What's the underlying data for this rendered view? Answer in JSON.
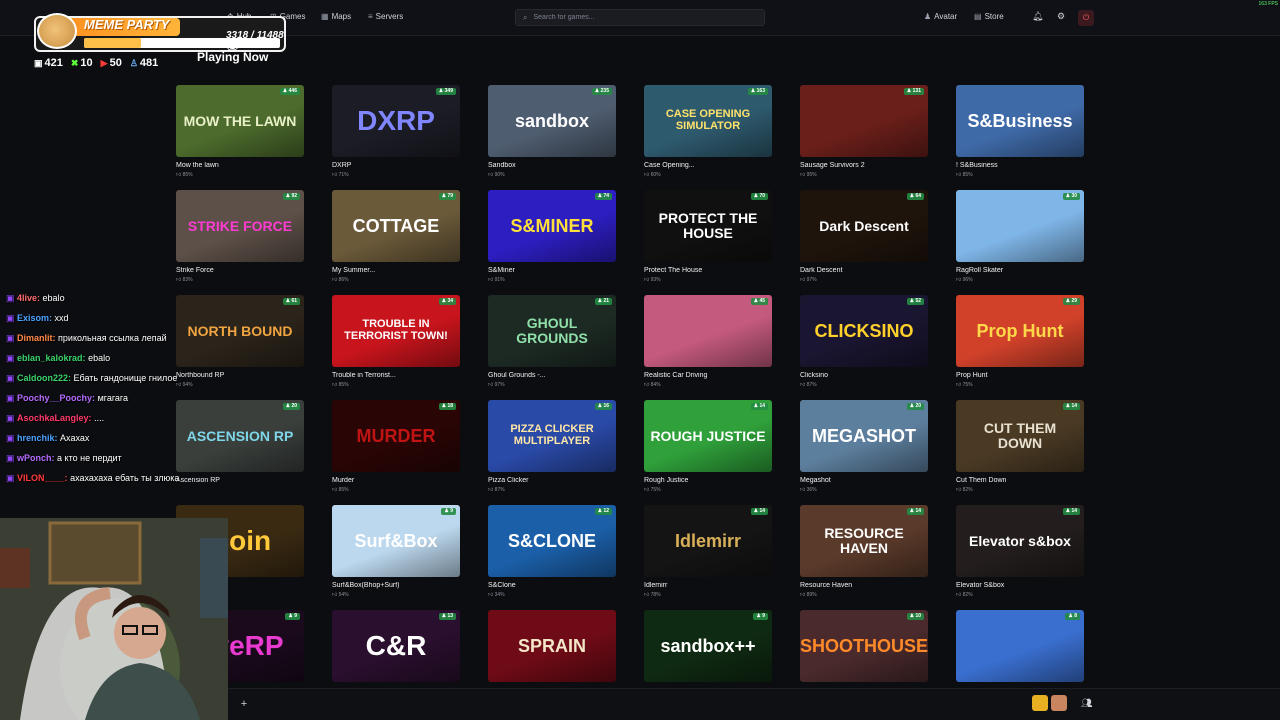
{
  "topbar": {
    "nav": [
      {
        "label": "Hub",
        "icon": "hub-icon"
      },
      {
        "label": "Games",
        "icon": "gamepad-icon"
      },
      {
        "label": "Maps",
        "icon": "map-icon"
      },
      {
        "label": "Servers",
        "icon": "list-icon"
      }
    ],
    "search_placeholder": "Search for games...",
    "avatar_label": "Avatar",
    "store_label": "Store",
    "fps": "163 FPS"
  },
  "section_title": "Playing Now",
  "games": [
    {
      "title": "Mow the lawn",
      "rating": "85%",
      "players": "446",
      "thumb_text": "MOW THE LAWN",
      "bg": "#4c6b2c",
      "fg": "#e8f0c8"
    },
    {
      "title": "DXRP",
      "rating": "71%",
      "players": "349",
      "thumb_text": "DXRP",
      "bg": "#1c1c26",
      "fg": "#7f86ff"
    },
    {
      "title": "Sandbox",
      "rating": "90%",
      "players": "235",
      "thumb_text": "sandbox",
      "bg": "#4f5d70",
      "fg": "#ffffff"
    },
    {
      "title": "Case Opening...",
      "rating": "60%",
      "players": "163",
      "thumb_text": "CASE OPENING SIMULATOR",
      "bg": "#2e5a6e",
      "fg": "#ffe26b"
    },
    {
      "title": "Sausage Survivors 2",
      "rating": "95%",
      "players": "131",
      "thumb_text": "",
      "bg": "#6b1f1a",
      "fg": "#ffffff"
    },
    {
      "title": "! S&Business",
      "rating": "85%",
      "players": "",
      "thumb_text": "S&Business",
      "bg": "#3f6aa8",
      "fg": "#ffffff"
    },
    {
      "title": "Strike Force",
      "rating": "83%",
      "players": "92",
      "thumb_text": "STRIKE FORCE",
      "bg": "#5d5048",
      "fg": "#ff3bd3"
    },
    {
      "title": "My Summer...",
      "rating": "86%",
      "players": "79",
      "thumb_text": "COTTAGE",
      "bg": "#6b5a3a",
      "fg": "#ffffff"
    },
    {
      "title": "S&Miner",
      "rating": "91%",
      "players": "74",
      "thumb_text": "S&MINER",
      "bg": "#2d1ec2",
      "fg": "#ffe03a"
    },
    {
      "title": "Protect The House",
      "rating": "93%",
      "players": "70",
      "thumb_text": "PROTECT THE HOUSE",
      "bg": "#101010",
      "fg": "#ffffff"
    },
    {
      "title": "Dark Descent",
      "rating": "97%",
      "players": "64",
      "thumb_text": "Dark Descent",
      "bg": "#1f140c",
      "fg": "#ffffff"
    },
    {
      "title": "RagRoll Skater",
      "rating": "96%",
      "players": "30",
      "thumb_text": "",
      "bg": "#7fb6e8",
      "fg": "#ffffff"
    },
    {
      "title": "Northbound RP",
      "rating": "94%",
      "players": "61",
      "thumb_text": "NORTH BOUND",
      "bg": "#2b241a",
      "fg": "#f0a441"
    },
    {
      "title": "Trouble in Terrorist...",
      "rating": "85%",
      "players": "34",
      "thumb_text": "TROUBLE IN TERRORIST TOWN!",
      "bg": "#c8141c",
      "fg": "#ffffff"
    },
    {
      "title": "Ghoul Grounds -...",
      "rating": "97%",
      "players": "21",
      "thumb_text": "GHOUL GROUNDS",
      "bg": "#1d2a24",
      "fg": "#8fe0a9"
    },
    {
      "title": "Realistic Car Driving",
      "rating": "84%",
      "players": "45",
      "thumb_text": "",
      "bg": "#c45a7d",
      "fg": "#ffffff"
    },
    {
      "title": "Clicksino",
      "rating": "87%",
      "players": "52",
      "thumb_text": "CLICKSINO",
      "bg": "#1a1530",
      "fg": "#ffd12a"
    },
    {
      "title": "Prop Hunt",
      "rating": "75%",
      "players": "29",
      "thumb_text": "Prop Hunt",
      "bg": "#d1412a",
      "fg": "#ffd84a"
    },
    {
      "title": "Ascension RP",
      "rating": "",
      "players": "20",
      "thumb_text": "ASCENSION RP",
      "bg": "#3a3f3c",
      "fg": "#7fd6e8"
    },
    {
      "title": "Murder",
      "rating": "85%",
      "players": "18",
      "thumb_text": "MURDER",
      "bg": "#2a0505",
      "fg": "#c01414"
    },
    {
      "title": "Pizza Clicker",
      "rating": "87%",
      "players": "16",
      "thumb_text": "PIZZA CLICKER MULTIPLAYER",
      "bg": "#2a4aa8",
      "fg": "#ffe7a6"
    },
    {
      "title": "Rough Justice",
      "rating": "75%",
      "players": "14",
      "thumb_text": "ROUGH JUSTICE",
      "bg": "#2fa03a",
      "fg": "#ffffff"
    },
    {
      "title": "Megashot",
      "rating": "36%",
      "players": "20",
      "thumb_text": "MEGASHOT",
      "bg": "#5d7f9e",
      "fg": "#ffffff"
    },
    {
      "title": "Cut Them Down",
      "rating": "82%",
      "players": "14",
      "thumb_text": "CUT THEM DOWN",
      "bg": "#4a3a24",
      "fg": "#e8e0d0"
    },
    {
      "title": "",
      "rating": "",
      "players": "",
      "thumb_text": "Coin",
      "bg": "#3a2a12",
      "fg": "#ffc93a"
    },
    {
      "title": "Surf&Box(Bhop+Surf)",
      "rating": "54%",
      "players": "9",
      "thumb_text": "Surf&Box",
      "bg": "#bcd8ee",
      "fg": "#ffffff"
    },
    {
      "title": "S&Clone",
      "rating": "34%",
      "players": "12",
      "thumb_text": "S&CLONE",
      "bg": "#1b5fa8",
      "fg": "#ffffff"
    },
    {
      "title": "Idlemirr",
      "rating": "78%",
      "players": "14",
      "thumb_text": "Idlemirr",
      "bg": "#141414",
      "fg": "#d8b05a"
    },
    {
      "title": "Resource Haven",
      "rating": "89%",
      "players": "14",
      "thumb_text": "RESOURCE HAVEN",
      "bg": "#5a3a2a",
      "fg": "#ffffff"
    },
    {
      "title": "Elevator S&box",
      "rating": "82%",
      "players": "14",
      "thumb_text": "Elevator s&box",
      "bg": "#231d1d",
      "fg": "#ffffff"
    },
    {
      "title": "",
      "rating": "",
      "players": "9",
      "thumb_text": "uveRP",
      "bg": "#1a0a1c",
      "fg": "#e93bd0"
    },
    {
      "title": "",
      "rating": "",
      "players": "13",
      "thumb_text": "C&R",
      "bg": "#2a0f2e",
      "fg": "#ffffff"
    },
    {
      "title": "",
      "rating": "",
      "players": "",
      "thumb_text": "SPRAIN",
      "bg": "#6e0b16",
      "fg": "#f4e6c8"
    },
    {
      "title": "",
      "rating": "",
      "players": "9",
      "thumb_text": "sandbox++",
      "bg": "#0f2a12",
      "fg": "#ffffff"
    },
    {
      "title": "",
      "rating": "",
      "players": "10",
      "thumb_text": "SHOOTHOUSE",
      "bg": "#4a2a2c",
      "fg": "#ff8a2a"
    },
    {
      "title": "",
      "rating": "",
      "players": "8",
      "thumb_text": "",
      "bg": "#3a6fd0",
      "fg": "#ffffff"
    }
  ],
  "overlay": {
    "logo_title": "MEME PARTY",
    "counter": "3318 / 11488",
    "progress": 0.289,
    "stats": [
      {
        "icon": "twitch-icon",
        "value": "421"
      },
      {
        "icon": "kick-icon",
        "value": "10"
      },
      {
        "icon": "vk-icon",
        "value": "50"
      },
      {
        "icon": "viewers-icon",
        "value": "481"
      }
    ],
    "accent_orange": "#ff9a22"
  },
  "chat": [
    {
      "user": "4live:",
      "text": "ebalo",
      "color": "#ff6b6b"
    },
    {
      "user": "Exisom:",
      "text": "xxd",
      "color": "#4aa3ff"
    },
    {
      "user": "Dimanlit:",
      "text": "прикольная ссылка лепай",
      "color": "#ff8844"
    },
    {
      "user": "eblan_kalokrad:",
      "text": "ebalo",
      "color": "#3ad26b"
    },
    {
      "user": "Caldoon222:",
      "text": "Ебать гандонище гнилое",
      "color": "#3ad26b"
    },
    {
      "user": "Poochy__Poochy:",
      "text": "мгагага",
      "color": "#b46bff"
    },
    {
      "user": "AsochkaLangley:",
      "text": "....",
      "color": "#ff3a6b"
    },
    {
      "user": "hrenchik:",
      "text": "Ахахах",
      "color": "#4aa3ff"
    },
    {
      "user": "wPonch:",
      "text": "а кто не пердит",
      "color": "#b46bff"
    },
    {
      "user": "VILON____:",
      "text": "ахахахаха ебать ты злюка",
      "color": "#ff3a3a"
    }
  ]
}
